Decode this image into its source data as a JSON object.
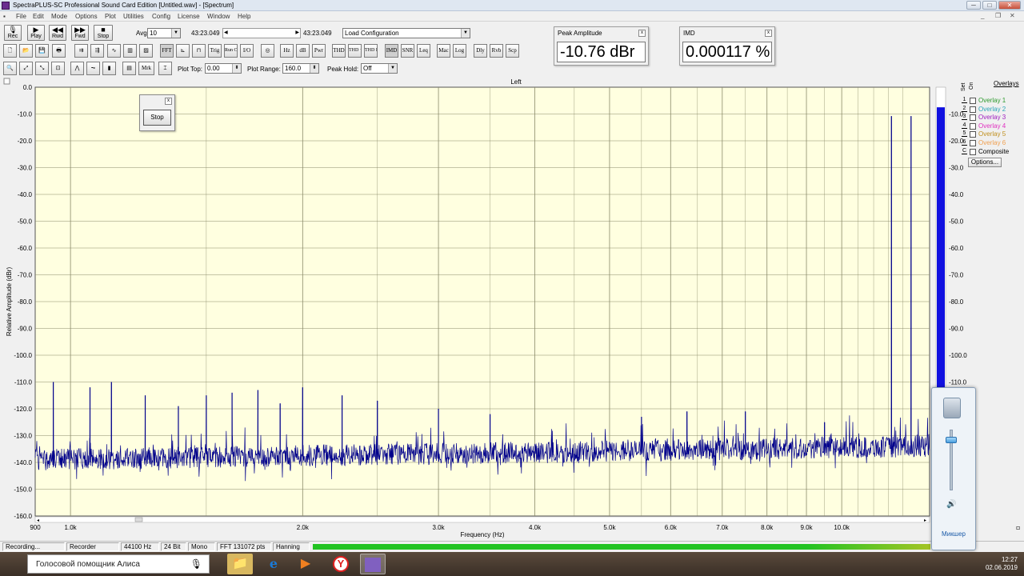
{
  "window": {
    "title": "SpectraPLUS-SC Professional Sound Card Edition [Untitled.wav] - [Spectrum]"
  },
  "menu": [
    "File",
    "Edit",
    "Mode",
    "Options",
    "Plot",
    "Utilities",
    "Config",
    "License",
    "Window",
    "Help"
  ],
  "transport": {
    "rec": "Rec",
    "play": "Play",
    "rwd": "Rwd",
    "fwd": "Fwd",
    "stop": "Stop",
    "avg_label": "Avg",
    "avg_value": "10",
    "time_start": "43:23.049",
    "time_end": "43:23.049",
    "config_value": "Load Configuration"
  },
  "toolbar2": [
    "FFT",
    "Trig",
    "Run Ctrl",
    "I/O",
    "Hz",
    "dB",
    "Pwr",
    "THD",
    "THD +N",
    "THD Freq",
    "IMD",
    "SNR",
    "Leq",
    "Mac",
    "Log",
    "Dly",
    "Rvb",
    "Scp"
  ],
  "toolbar3": {
    "mrk": "Mrk",
    "plot_top_label": "Plot Top:",
    "plot_top_value": "0.00",
    "plot_range_label": "Plot Range:",
    "plot_range_value": "160.0",
    "peak_hold_label": "Peak Hold:",
    "peak_hold_value": "Off"
  },
  "meters": {
    "peak": {
      "title": "Peak Amplitude",
      "value": "-10.76 dBr"
    },
    "imd": {
      "title": "IMD",
      "value": "0.000117 %"
    }
  },
  "stop_window": {
    "button": "Stop"
  },
  "chart_data": {
    "type": "line",
    "title": "Left",
    "xlabel": "Frequency (Hz)",
    "ylabel": "Relative Amplitude (dBr)",
    "xscale": "log",
    "xlim": [
      900,
      13000
    ],
    "ylim": [
      -160,
      0
    ],
    "yticks": [
      "0.0",
      "-10.0",
      "-20.0",
      "-30.0",
      "-40.0",
      "-50.0",
      "-60.0",
      "-70.0",
      "-80.0",
      "-90.0",
      "-100.0",
      "-110.0",
      "-120.0",
      "-130.0",
      "-140.0",
      "-150.0",
      "-160.0"
    ],
    "xticks": [
      {
        "v": 900,
        "label": "900"
      },
      {
        "v": 1000,
        "label": "1.0k"
      },
      {
        "v": 2000,
        "label": "2.0k"
      },
      {
        "v": 3000,
        "label": "3.0k"
      },
      {
        "v": 4000,
        "label": "4.0k"
      },
      {
        "v": 5000,
        "label": "5.0k"
      },
      {
        "v": 6000,
        "label": "6.0k"
      },
      {
        "v": 7000,
        "label": "7.0k"
      },
      {
        "v": 8000,
        "label": "8.0k"
      },
      {
        "v": 9000,
        "label": "9.0k"
      },
      {
        "v": 10000,
        "label": "10.0k"
      }
    ],
    "grid": true,
    "noise_floor_db": -139,
    "series": [
      {
        "values": [
          {
            "x": 950,
            "y": -110
          },
          {
            "x": 1060,
            "y": -112
          },
          {
            "x": 1130,
            "y": -110
          },
          {
            "x": 1250,
            "y": -115
          },
          {
            "x": 1380,
            "y": -119
          },
          {
            "x": 1500,
            "y": -115
          },
          {
            "x": 1620,
            "y": -114
          },
          {
            "x": 1750,
            "y": -113
          },
          {
            "x": 1870,
            "y": -118
          },
          {
            "x": 2000,
            "y": -112
          },
          {
            "x": 2250,
            "y": -115
          },
          {
            "x": 2500,
            "y": -117
          },
          {
            "x": 3000,
            "y": -120
          },
          {
            "x": 3500,
            "y": -122
          },
          {
            "x": 5500,
            "y": -123
          },
          {
            "x": 6300,
            "y": -121
          },
          {
            "x": 7500,
            "y": -121
          },
          {
            "x": 9500,
            "y": -125
          },
          {
            "x": 11600,
            "y": -10.8
          },
          {
            "x": 12300,
            "y": -10.8
          }
        ]
      }
    ]
  },
  "level_meter": {
    "level_db": -7.5,
    "ticks": [
      "-10.0",
      "-20.0",
      "-30.0",
      "-40.0",
      "-50.0",
      "-60.0",
      "-70.0",
      "-80.0",
      "-90.0",
      "-100.0",
      "-110.0"
    ]
  },
  "overlays": {
    "title": "Overlays",
    "set_label": "Set",
    "on_label": "On",
    "items": [
      {
        "num": "1",
        "label": "Overlay 1",
        "color": "#2e9a2e"
      },
      {
        "num": "2",
        "label": "Overlay 2",
        "color": "#2aa6b8"
      },
      {
        "num": "3",
        "label": "Overlay 3",
        "color": "#a020c0"
      },
      {
        "num": "4",
        "label": "Overlay 4",
        "color": "#e030c0"
      },
      {
        "num": "5",
        "label": "Overlay 5",
        "color": "#c09020"
      },
      {
        "num": "6",
        "label": "Overlay 6",
        "color": "#f0a050"
      },
      {
        "num": "C",
        "label": "Composite",
        "color": "#000000"
      }
    ],
    "options": "Options..."
  },
  "status": {
    "state": "Recording...",
    "mode": "Recorder",
    "rate": "44100 Hz",
    "bits": "24 Bit",
    "channels": "Mono",
    "fft": "FFT 131072 pts",
    "window": "Hanning",
    "progress": 1.0
  },
  "taskbar": {
    "search_text": "Голосовой помощник Алиса",
    "time": "12:27",
    "date": "02.06.2019"
  },
  "volume": {
    "mixer": "Микшер",
    "level": 0.2
  },
  "colors": {
    "plot_bg": "#ffffe0",
    "trace": "#00008b",
    "meter_bar": "#1010e0",
    "grid": "#8a8a6a"
  }
}
